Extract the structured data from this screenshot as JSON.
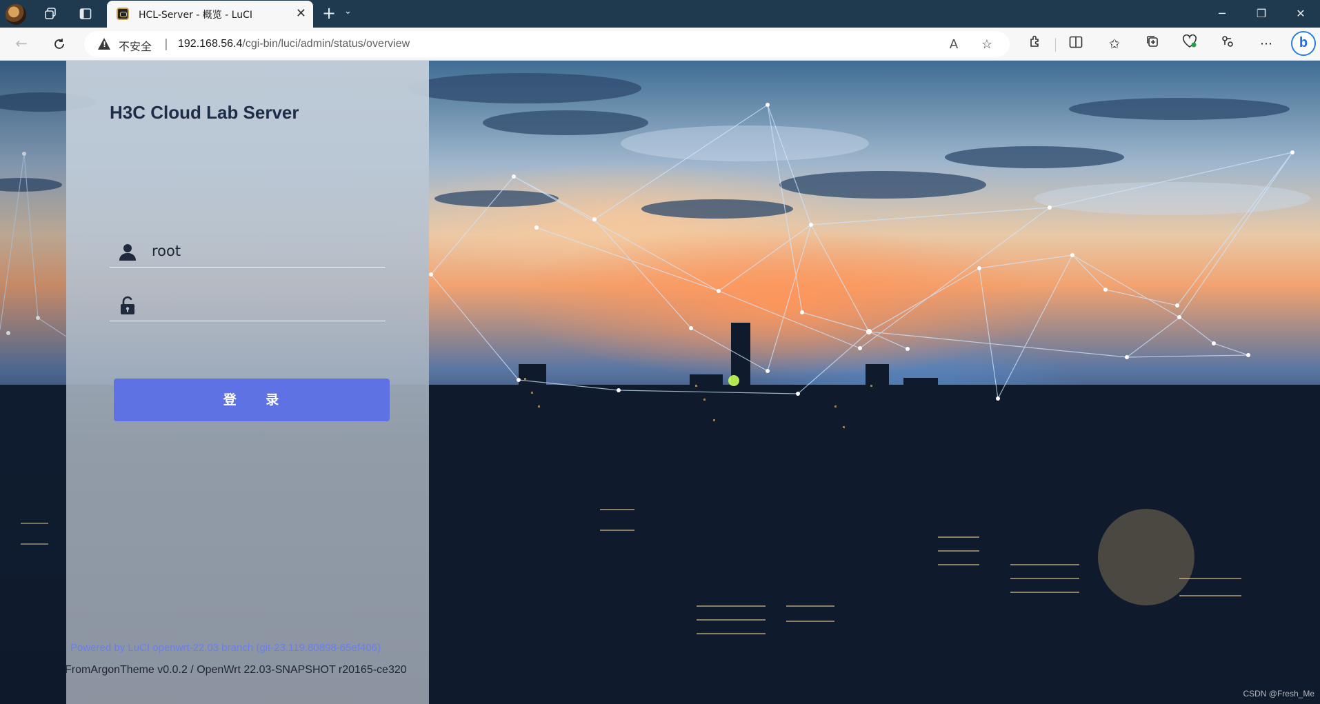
{
  "browser": {
    "tab": {
      "title": "HCL-Server - 概览 - LuCI",
      "favicon": "luci-logo-icon"
    },
    "address_bar": {
      "security_label": "不安全",
      "separator": "|",
      "url_host": "192.168.56.4",
      "url_path": "/cgi-bin/luci/admin/status/overview"
    },
    "icons": [
      "profile-avatar",
      "workspaces-icon",
      "tab-actions-icon",
      "new-tab-icon",
      "tab-list-icon",
      "back-icon",
      "refresh-icon",
      "read-aloud-icon",
      "favorite-star-icon",
      "extensions-icon",
      "split-screen-icon",
      "favorites-icon",
      "collections-icon",
      "browser-essentials-icon",
      "share-icon",
      "more-icon",
      "bing-copilot-icon",
      "minimize-icon",
      "restore-icon",
      "close-icon"
    ],
    "bing_label": "b"
  },
  "login": {
    "brand": "H3C Cloud Lab Server",
    "username_value": "root",
    "password_value": "",
    "login_button": "登 录"
  },
  "footer": {
    "powered": "Powered by LuCI openwrt-22.03 branch (git-23.119.80898-65ef406)",
    "theme": "FromArgonTheme v0.0.2 / OpenWrt 22.03-SNAPSHOT r20165-ce320"
  },
  "watermark": "CSDN @Fresh_Me",
  "colors": {
    "accent": "#5e72e4",
    "footer_link": "#6a7ef0",
    "titlebar": "#1f3a4f"
  }
}
